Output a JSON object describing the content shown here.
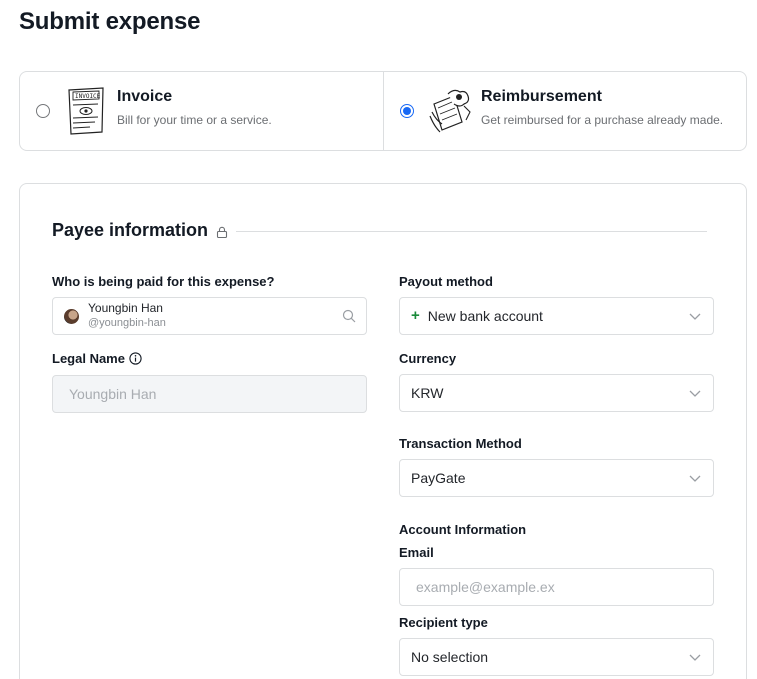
{
  "page": {
    "title": "Submit expense"
  },
  "expense_types": [
    {
      "title": "Invoice",
      "description": "Bill for your time or a service.",
      "selected": false
    },
    {
      "title": "Reimbursement",
      "description": "Get reimbursed for a purchase already made.",
      "selected": true
    }
  ],
  "payee_section": {
    "title": "Payee information",
    "payee_label": "Who is being paid for this expense?",
    "payee": {
      "name": "Youngbin Han",
      "handle": "@youngbin-han"
    },
    "legal_name_label": "Legal Name",
    "legal_name_value": "Youngbin Han",
    "payout_method_label": "Payout method",
    "payout_method_value": "New bank account",
    "currency_label": "Currency",
    "currency_value": "KRW",
    "transaction_method_label": "Transaction Method",
    "transaction_method_value": "PayGate",
    "account_info_heading": "Account Information",
    "email_label": "Email",
    "email_placeholder": "example@example.ex",
    "recipient_type_label": "Recipient type",
    "recipient_type_value": "No selection"
  },
  "colors": {
    "accent": "#1869f5",
    "border": "#dcdee0",
    "plus": "#1a8a3a"
  }
}
